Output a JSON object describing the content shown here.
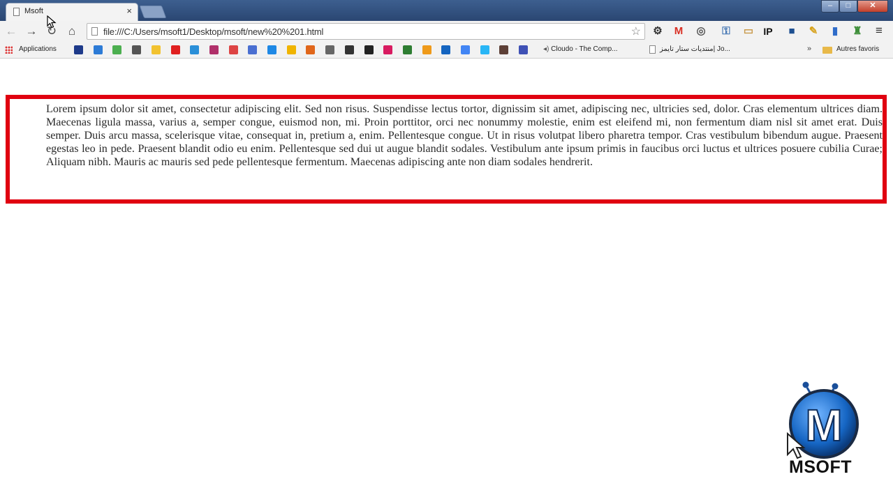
{
  "window": {
    "tab_title": "Msoft",
    "tab_close": "×",
    "controls": {
      "minimize": "–",
      "maximize": "□",
      "close": "✕"
    }
  },
  "toolbar": {
    "back_icon": "←",
    "forward_icon": "→",
    "reload_icon": "↻",
    "home_icon": "⌂",
    "url": "file:///C:/Users/msoft1/Desktop/msoft/new%20%201.html",
    "star_icon": "☆",
    "menu_icon": "≡",
    "extensions": [
      {
        "name": "gear-icon",
        "glyph": "⚙",
        "color": "#333333"
      },
      {
        "name": "gmail-icon",
        "glyph": "M",
        "color": "#d93025"
      },
      {
        "name": "spiral-icon",
        "glyph": "◎",
        "color": "#555555"
      },
      {
        "name": "key-icon",
        "glyph": "⚿",
        "color": "#3a6fb0"
      },
      {
        "name": "note-icon",
        "glyph": "▭",
        "color": "#c99a4b"
      },
      {
        "name": "ip-icon",
        "glyph": "IP",
        "color": "#111111"
      },
      {
        "name": "blue-square-icon",
        "glyph": "■",
        "color": "#1d4f91"
      },
      {
        "name": "pen-icon",
        "glyph": "✎",
        "color": "#d7a21b"
      },
      {
        "name": "chart-icon",
        "glyph": "▮",
        "color": "#2f6cc9"
      },
      {
        "name": "mosque-icon",
        "glyph": "♜",
        "color": "#3f8f3a"
      }
    ]
  },
  "bookmarks": {
    "apps_label": "Applications",
    "favicons": [
      "#1e3a8a",
      "#2d7bd6",
      "#4caf50",
      "#555555",
      "#f2c230",
      "#e02020",
      "#2a8fd8",
      "#b0306a",
      "#d44",
      "#4a6fd1",
      "#1e88e5",
      "#f0b400",
      "#e0661a",
      "#666666",
      "#333333",
      "#222222",
      "#d81b60",
      "#2e7d32",
      "#ef9a1a",
      "#1565c0",
      "#4285f4",
      "#29b6f6",
      "#5d4037",
      "#3f51b5"
    ],
    "cloudo_label": "Cloudo - The Comp...",
    "arabic_label": "منتديات ستار تايمز| Jo...",
    "other_label": "Autres favoris",
    "chevron": "»"
  },
  "page": {
    "paragraph": "Lorem ipsum dolor sit amet, consectetur adipiscing elit. Sed non risus. Suspendisse lectus tortor, dignissim sit amet, adipiscing nec, ultricies sed, dolor. Cras elementum ultrices diam. Maecenas ligula massa, varius a, semper congue, euismod non, mi. Proin porttitor, orci nec nonummy molestie, enim est eleifend mi, non fermentum diam nisl sit amet erat. Duis semper. Duis arcu massa, scelerisque vitae, consequat in, pretium a, enim. Pellentesque congue. Ut in risus volutpat libero pharetra tempor. Cras vestibulum bibendum augue. Praesent egestas leo in pede. Praesent blandit odio eu enim. Pellentesque sed dui ut augue blandit sodales. Vestibulum ante ipsum primis in faucibus orci luctus et ultrices posuere cubilia Curae; Aliquam nibh. Mauris ac mauris sed pede pellentesque fermentum. Maecenas adipiscing ante non diam sodales hendrerit.",
    "border_color": "#e00010"
  },
  "watermark": {
    "logo_letter": "M",
    "logo_text": "MSOFT"
  }
}
